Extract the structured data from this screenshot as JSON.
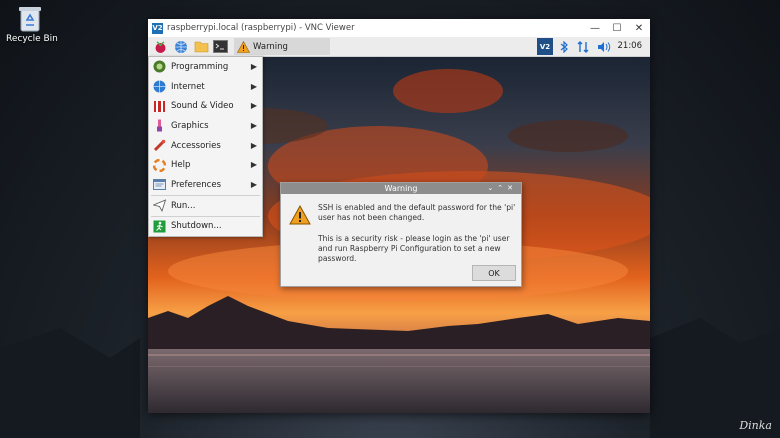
{
  "desktop": {
    "recycle_label": "Recycle Bin",
    "signature": "Dinka"
  },
  "vnc": {
    "logo_text": "V2",
    "title": "raspberrypi.local (raspberrypi) - VNC Viewer"
  },
  "taskbar": {
    "active_window": "Warning",
    "clock": "21:06",
    "vnc_tray": "V2"
  },
  "menu": {
    "items": [
      {
        "label": "Programming"
      },
      {
        "label": "Internet"
      },
      {
        "label": "Sound & Video"
      },
      {
        "label": "Graphics"
      },
      {
        "label": "Accessories"
      },
      {
        "label": "Help"
      },
      {
        "label": "Preferences"
      },
      {
        "label": "Run..."
      },
      {
        "label": "Shutdown..."
      }
    ]
  },
  "dialog": {
    "title": "Warning",
    "line1": "SSH is enabled and the default password for the 'pi' user has not been changed.",
    "line2": "This is a security risk - please login as the 'pi' user and run Raspberry Pi Configuration to set a new password.",
    "ok_label": "OK"
  }
}
